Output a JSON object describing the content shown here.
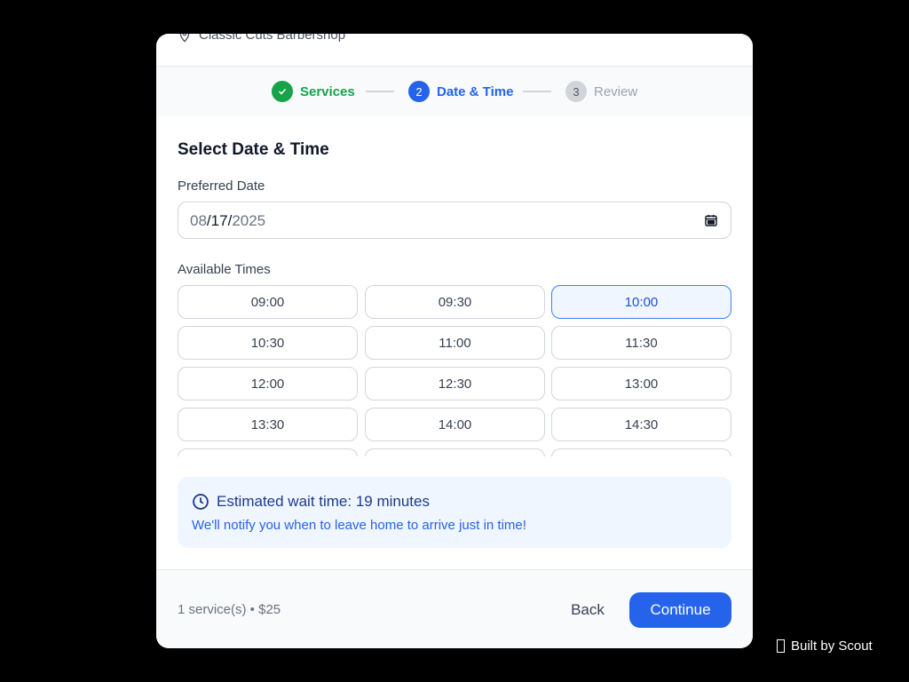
{
  "header": {
    "shop_name": "Classic Cuts Barbershop",
    "location_icon": "map-pin-icon"
  },
  "steps": [
    {
      "number": "✓",
      "label": "Services",
      "state": "completed"
    },
    {
      "number": "2",
      "label": "Date & Time",
      "state": "active"
    },
    {
      "number": "3",
      "label": "Review",
      "state": "upcoming"
    }
  ],
  "main": {
    "title": "Select Date & Time",
    "date_label": "Preferred Date",
    "date_month": "08",
    "date_day": "17",
    "date_year": "2025",
    "calendar_icon": "calendar-icon",
    "times_label": "Available Times",
    "selected_time": "10:00",
    "time_slots": [
      "09:00",
      "09:30",
      "10:00",
      "10:30",
      "11:00",
      "11:30",
      "12:00",
      "12:30",
      "13:00",
      "13:30",
      "14:00",
      "14:30"
    ]
  },
  "wait": {
    "icon": "clock-icon",
    "title": "Estimated wait time: 19 minutes",
    "subtitle": "We'll notify you when to leave home to arrive just in time!"
  },
  "footer": {
    "summary": "1 service(s) • $25",
    "back_label": "Back",
    "continue_label": "Continue"
  },
  "branding": {
    "built_by": "Built by Scout"
  },
  "colors": {
    "accent": "#2563eb",
    "success": "#16a34a",
    "background": "#000000"
  }
}
